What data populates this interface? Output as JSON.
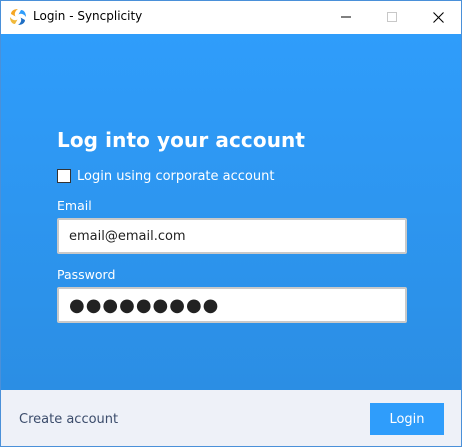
{
  "window": {
    "title": "Login - Syncplicity",
    "app_icon": "syncplicity-logo-icon",
    "controls": [
      "minimize-icon",
      "maximize-icon",
      "close-icon"
    ]
  },
  "login_form": {
    "heading": "Log into your account",
    "corporate_checkbox_label": "Login using corporate account",
    "corporate_checked": false,
    "email_label": "Email",
    "email_value": "email@email.com",
    "password_label": "Password",
    "password_value": "●●●●●●●●●"
  },
  "footer": {
    "create_account_label": "Create account",
    "login_button_label": "Login"
  },
  "colors": {
    "accent": "#2f9dfb",
    "footer_bg": "#eef1f8"
  }
}
